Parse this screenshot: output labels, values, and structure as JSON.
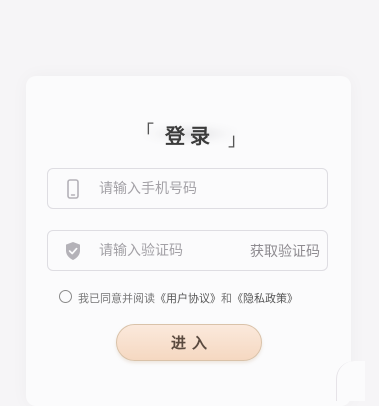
{
  "login": {
    "bracket_left": "「",
    "title": "登录",
    "bracket_right": "」",
    "phone_placeholder": "请输入手机号码",
    "code_placeholder": "请输入验证码",
    "get_code_label": "获取验证码",
    "agreement_prefix": "我已同意并阅读",
    "user_agreement": "《用户协议》",
    "agreement_and": "和",
    "privacy_policy": "《隐私政策》",
    "submit_label": "进入"
  },
  "icons": {
    "phone": "phone-icon",
    "shield": "shield-check-icon",
    "radio": "radio-unchecked"
  },
  "colors": {
    "background": "#f6f5f7",
    "card": "#fbfbfc",
    "field_border": "#dedde2",
    "placeholder": "#a3a1a6",
    "button_gradient_top": "#fbe9dc",
    "button_gradient_bottom": "#f5d8c1",
    "button_text": "#5a4a3f"
  }
}
